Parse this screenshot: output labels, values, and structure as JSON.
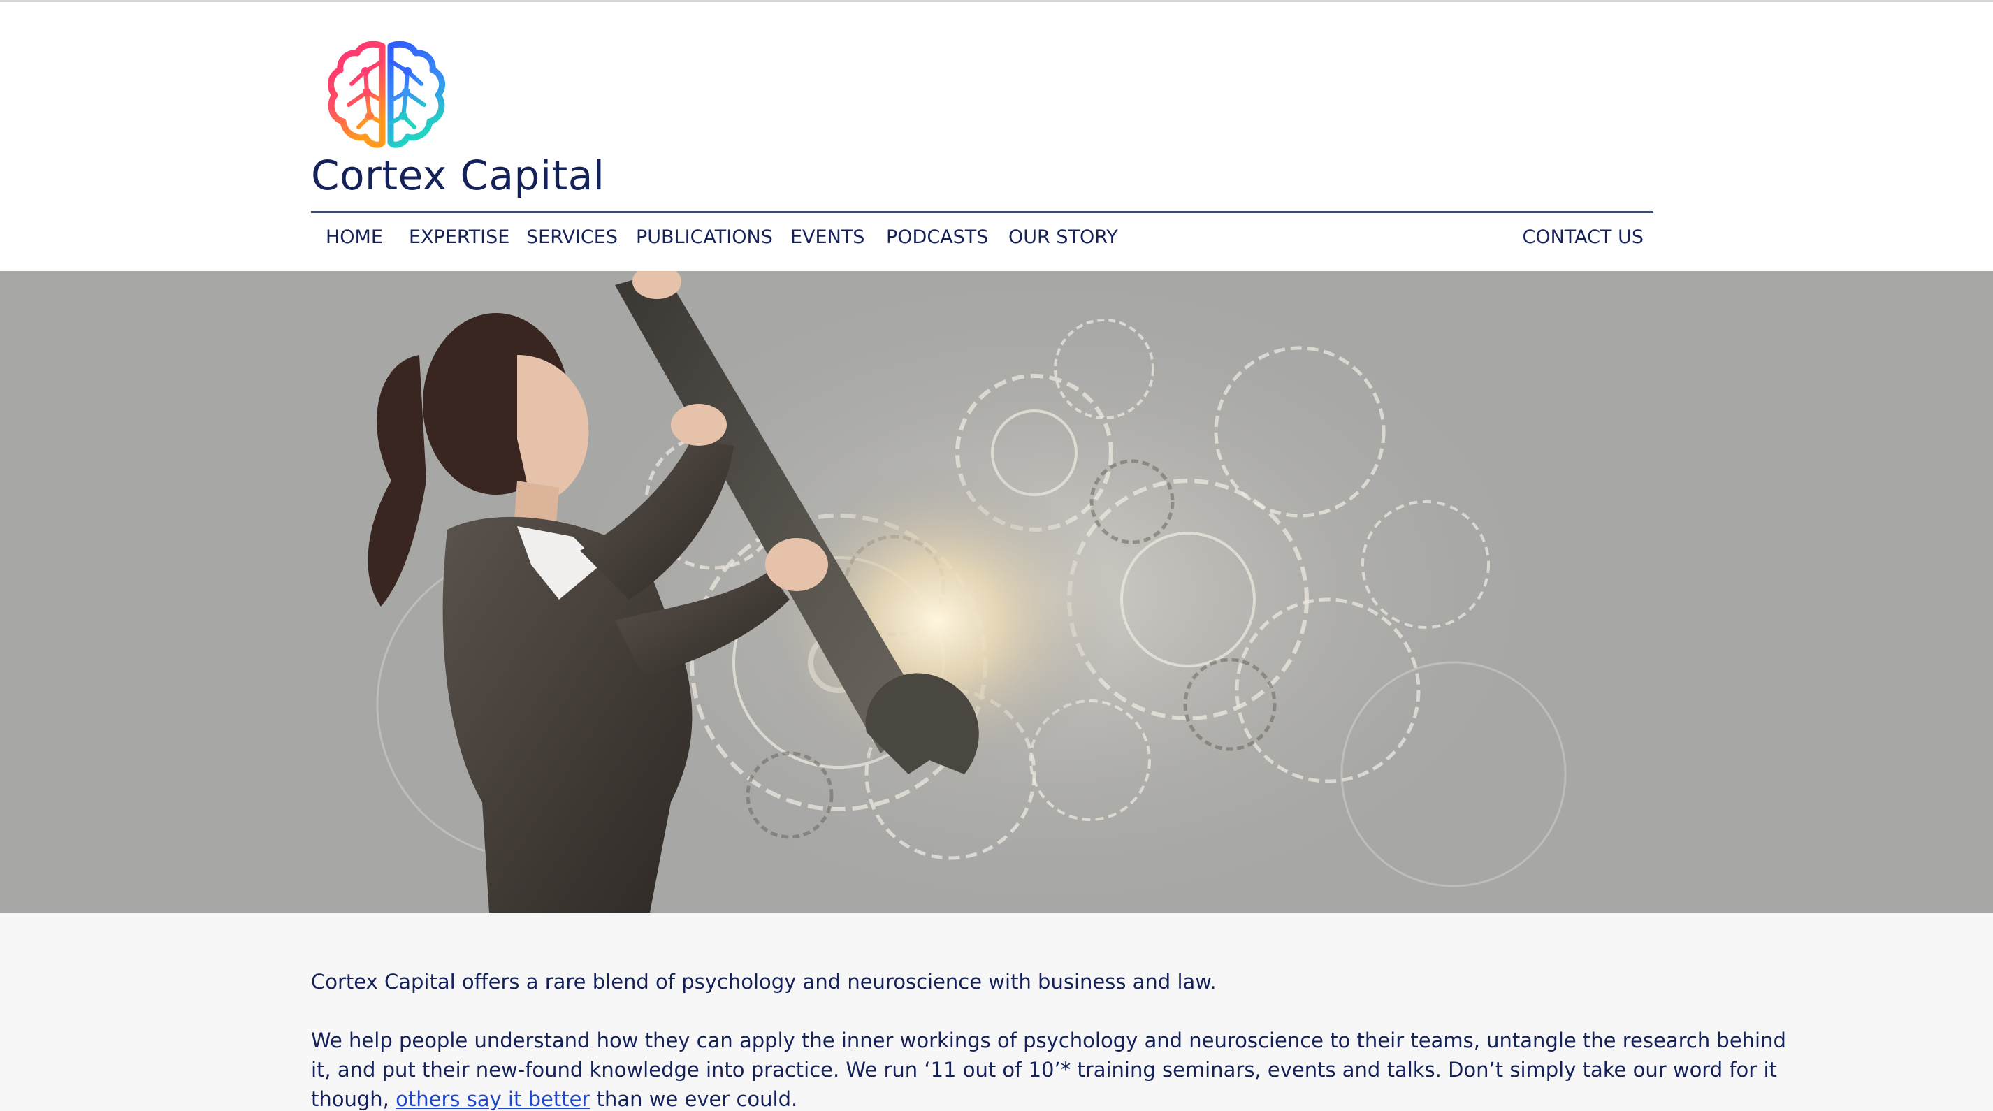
{
  "brand": {
    "name": "Cortex Capital",
    "logo_icon": "brain-network-logo",
    "logo_colors": [
      "#ff2a78",
      "#ff8a1e",
      "#2f6bff",
      "#22d3c5"
    ]
  },
  "nav": {
    "items": [
      {
        "label": "HOME"
      },
      {
        "label": "EXPERTISE"
      },
      {
        "label": "SERVICES"
      },
      {
        "label": "PUBLICATIONS"
      },
      {
        "label": "EVENTS"
      },
      {
        "label": "PODCASTS"
      },
      {
        "label": "OUR STORY"
      }
    ],
    "contact": "CONTACT US"
  },
  "hero": {
    "image": "woman-with-wrench-and-gears-photo"
  },
  "intro": {
    "paragraph1": "Cortex Capital offers a rare blend of psychology and neuroscience with business and law.",
    "paragraph2_line1": "We help people understand how they can apply the inner workings of psychology and neuroscience to their teams, untangle the research behind",
    "paragraph2_line2": "it, and put their new-found knowledge into practice. We run ‘11 out of 10’* training seminars, events and talks. Don’t simply take our word for it",
    "paragraph2_line3_pre": "though, ",
    "paragraph2_link": "others say it better",
    "paragraph2_line3_post": " than we ever could."
  },
  "colors": {
    "text": "#15225a",
    "link": "#1f46c8",
    "rule": "#3c4a6e",
    "content_bg": "#f7f7f8"
  }
}
